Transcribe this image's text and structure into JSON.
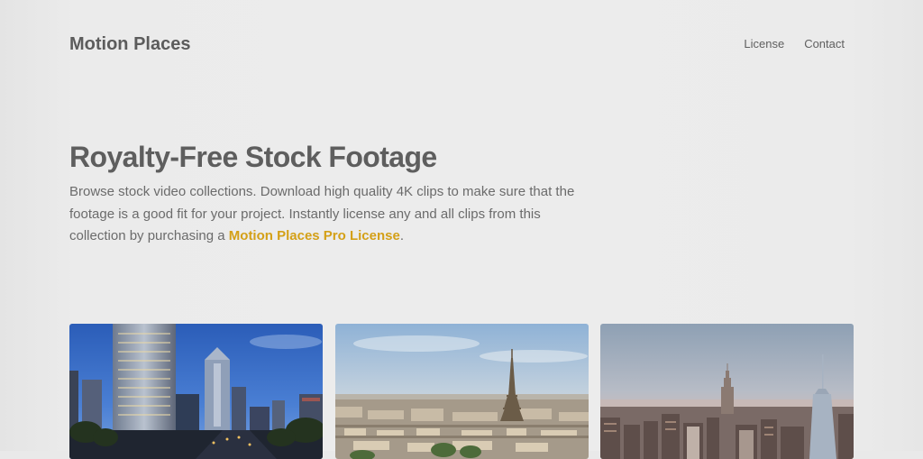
{
  "header": {
    "logo": "Motion Places",
    "nav": [
      "License",
      "Contact"
    ]
  },
  "hero": {
    "title": "Royalty-Free Stock Footage",
    "description_before": "Browse stock video collections. Download high quality 4K clips to make sure that the footage is a good fit for your project. Instantly license any and all clips from this collection by purchasing a ",
    "description_link": "Motion Places Pro License",
    "description_after": "."
  },
  "colors": {
    "accent": "#d4a017",
    "text": "#5f5f5f",
    "background": "#ebebeb"
  },
  "cards": [
    {
      "scene": "los-angeles-downtown-skyline"
    },
    {
      "scene": "paris-eiffel-tower-aerial"
    },
    {
      "scene": "new-york-manhattan-skyline"
    }
  ]
}
